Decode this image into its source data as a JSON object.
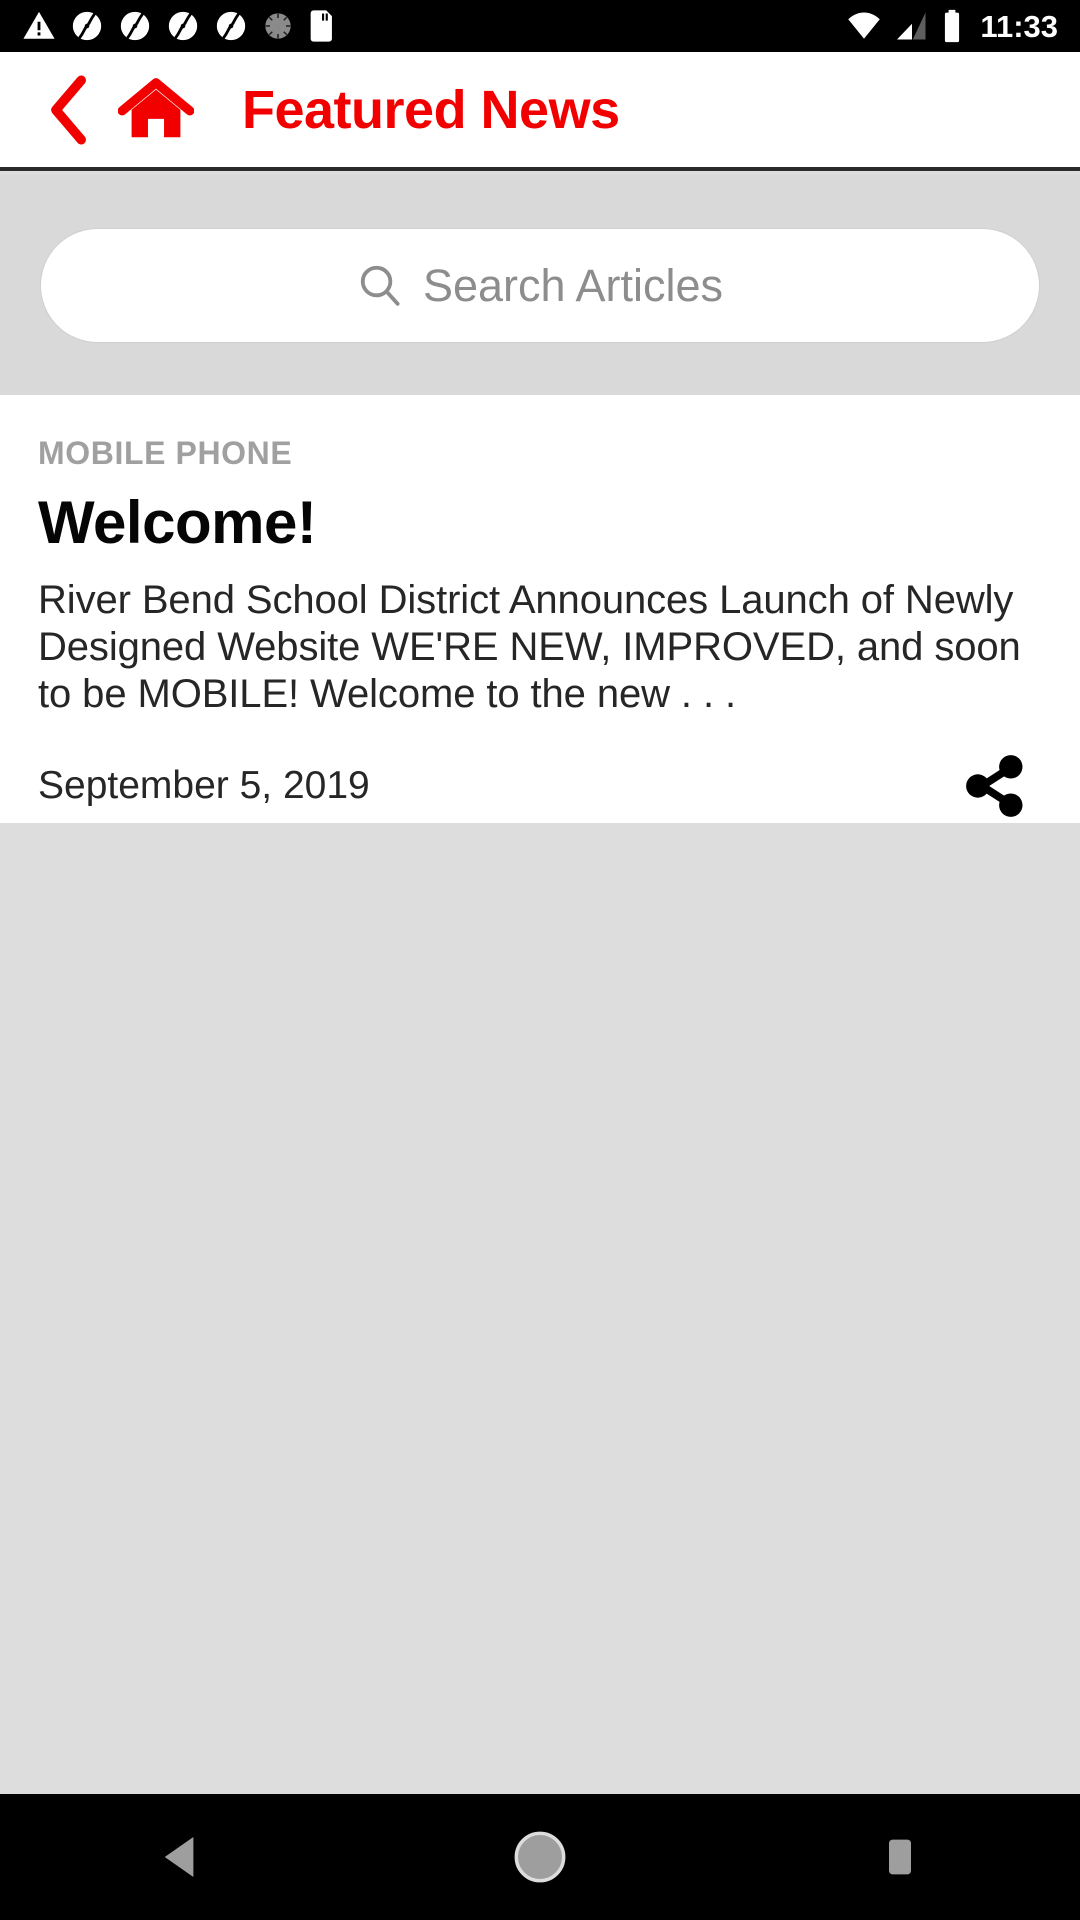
{
  "statusbar": {
    "time": "11:33",
    "left_icons": [
      {
        "name": "warning-triangle-icon"
      },
      {
        "name": "sync-icon"
      },
      {
        "name": "sync-icon"
      },
      {
        "name": "sync-icon"
      },
      {
        "name": "sync-icon"
      },
      {
        "name": "sync-disabled-icon"
      },
      {
        "name": "sd-card-icon"
      }
    ],
    "right_icons": [
      {
        "name": "wifi-icon"
      },
      {
        "name": "cellular-signal-icon"
      },
      {
        "name": "battery-full-icon"
      }
    ],
    "background": "#000000",
    "foreground": "#FFFFFF"
  },
  "header": {
    "title": "Featured News",
    "back_icon": "chevron-left-icon",
    "home_icon": "home-icon",
    "accent_color": "#F20000",
    "background": "#FFFFFF"
  },
  "search": {
    "placeholder": "Search Articles",
    "value": "",
    "icon": "search-icon",
    "background": "#D9D9D9"
  },
  "article": {
    "category": "MOBILE PHONE",
    "headline": "Welcome!",
    "summary": "River Bend School District Announces Launch of Newly Designed Website WE'RE NEW, IMPROVED, and soon to be MOBILE! Welcome to the new . . .",
    "date": "September 5, 2019",
    "share_icon": "share-icon",
    "background": "#FFFFFF"
  },
  "page": {
    "empty_background": "#DDDDDD"
  },
  "navbar": {
    "background": "#000000",
    "icon_color": "#9E9E9E",
    "buttons": [
      {
        "name": "back-button",
        "icon": "triangle-left-icon"
      },
      {
        "name": "home-button",
        "icon": "circle-icon"
      },
      {
        "name": "recents-button",
        "icon": "square-icon"
      }
    ]
  }
}
